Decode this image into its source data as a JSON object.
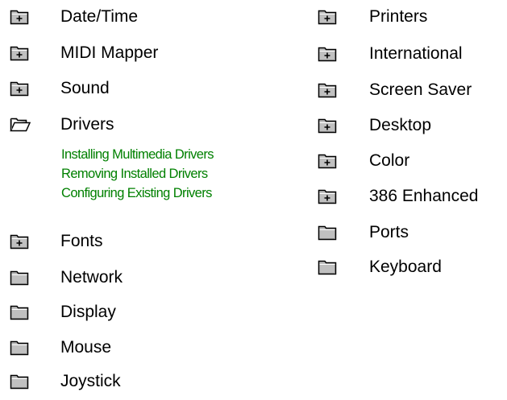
{
  "colors": {
    "topic_text": "#000000",
    "link_text": "#008000",
    "folder_fill": "#c0c0c0",
    "folder_outline": "#000000"
  },
  "left_column": [
    {
      "label": "Date/Time",
      "icon": "folder-plus-icon"
    },
    {
      "label": "MIDI Mapper",
      "icon": "folder-plus-icon"
    },
    {
      "label": "Sound",
      "icon": "folder-plus-icon"
    },
    {
      "label": "Drivers",
      "icon": "folder-open-icon",
      "subtopics": [
        "Installing Multimedia Drivers",
        "Removing Installed Drivers",
        "Configuring Existing Drivers"
      ]
    },
    {
      "label": "Fonts",
      "icon": "folder-plus-icon"
    },
    {
      "label": "Network",
      "icon": "folder-icon"
    },
    {
      "label": "Display",
      "icon": "folder-icon"
    },
    {
      "label": "Mouse",
      "icon": "folder-icon"
    },
    {
      "label": "Joystick",
      "icon": "folder-icon"
    }
  ],
  "right_column": [
    {
      "label": "Printers",
      "icon": "folder-plus-icon"
    },
    {
      "label": "International",
      "icon": "folder-plus-icon"
    },
    {
      "label": "Screen Saver",
      "icon": "folder-plus-icon"
    },
    {
      "label": "Desktop",
      "icon": "folder-plus-icon"
    },
    {
      "label": "Color",
      "icon": "folder-plus-icon"
    },
    {
      "label": "386 Enhanced",
      "icon": "folder-plus-icon"
    },
    {
      "label": "Ports",
      "icon": "folder-icon"
    },
    {
      "label": "Keyboard",
      "icon": "folder-icon"
    }
  ]
}
